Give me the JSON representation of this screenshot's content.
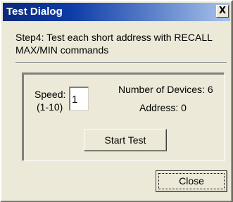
{
  "window": {
    "title": "Test Dialog",
    "close_glyph": "X"
  },
  "instructions": {
    "text": "Step4: Test each short address with RECALL MAX/MIN commands"
  },
  "test_group": {
    "speed_label": "Speed:",
    "speed_range": "(1-10)",
    "speed_value": "1",
    "num_devices_text": "Number of Devices: 6",
    "address_text": "Address: 0",
    "start_button_label": "Start Test"
  },
  "footer": {
    "close_button_label": "Close"
  },
  "colors": {
    "title_bar_dark": "#0b2a7a",
    "title_bar_light": "#a9c3ea",
    "dialog_face": "#ece9d8"
  }
}
